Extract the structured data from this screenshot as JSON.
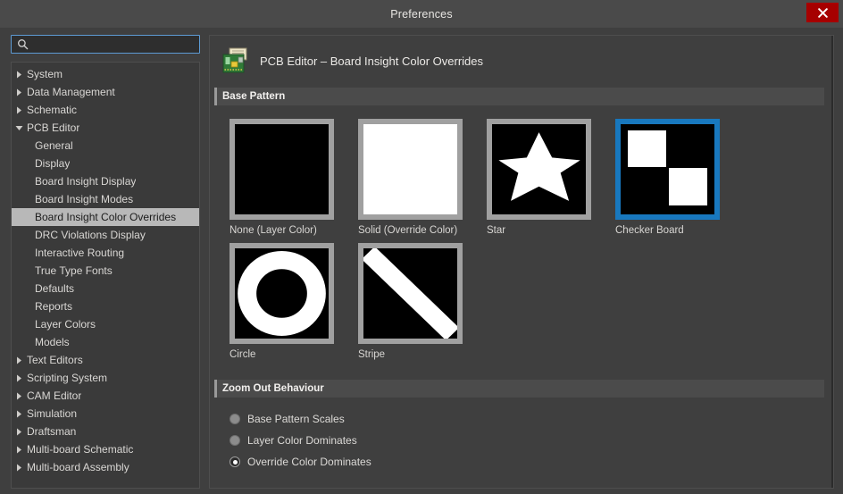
{
  "window": {
    "title": "Preferences",
    "close_label": "x",
    "close_icon": "close-icon",
    "close_color": "#a60000"
  },
  "search": {
    "value": "",
    "placeholder": "",
    "icon": "search-icon"
  },
  "tree": {
    "items": [
      {
        "label": "System",
        "depth": 0,
        "arrow": "collapsed",
        "selected": false
      },
      {
        "label": "Data Management",
        "depth": 0,
        "arrow": "collapsed",
        "selected": false
      },
      {
        "label": "Schematic",
        "depth": 0,
        "arrow": "collapsed",
        "selected": false
      },
      {
        "label": "PCB Editor",
        "depth": 0,
        "arrow": "expanded",
        "selected": false
      },
      {
        "label": "General",
        "depth": 1,
        "arrow": "none",
        "selected": false
      },
      {
        "label": "Display",
        "depth": 1,
        "arrow": "none",
        "selected": false
      },
      {
        "label": "Board Insight Display",
        "depth": 1,
        "arrow": "none",
        "selected": false
      },
      {
        "label": "Board Insight Modes",
        "depth": 1,
        "arrow": "none",
        "selected": false
      },
      {
        "label": "Board Insight Color Overrides",
        "depth": 1,
        "arrow": "none",
        "selected": true
      },
      {
        "label": "DRC Violations Display",
        "depth": 1,
        "arrow": "none",
        "selected": false
      },
      {
        "label": "Interactive Routing",
        "depth": 1,
        "arrow": "none",
        "selected": false
      },
      {
        "label": "True Type Fonts",
        "depth": 1,
        "arrow": "none",
        "selected": false
      },
      {
        "label": "Defaults",
        "depth": 1,
        "arrow": "none",
        "selected": false
      },
      {
        "label": "Reports",
        "depth": 1,
        "arrow": "none",
        "selected": false
      },
      {
        "label": "Layer Colors",
        "depth": 1,
        "arrow": "none",
        "selected": false
      },
      {
        "label": "Models",
        "depth": 1,
        "arrow": "none",
        "selected": false
      },
      {
        "label": "Text Editors",
        "depth": 0,
        "arrow": "collapsed",
        "selected": false
      },
      {
        "label": "Scripting System",
        "depth": 0,
        "arrow": "collapsed",
        "selected": false
      },
      {
        "label": "CAM Editor",
        "depth": 0,
        "arrow": "collapsed",
        "selected": false
      },
      {
        "label": "Simulation",
        "depth": 0,
        "arrow": "collapsed",
        "selected": false
      },
      {
        "label": "Draftsman",
        "depth": 0,
        "arrow": "collapsed",
        "selected": false
      },
      {
        "label": "Multi-board Schematic",
        "depth": 0,
        "arrow": "collapsed",
        "selected": false
      },
      {
        "label": "Multi-board Assembly",
        "depth": 0,
        "arrow": "collapsed",
        "selected": false
      }
    ]
  },
  "page": {
    "title": "PCB Editor – Board Insight Color Overrides",
    "icon": "pcb-board-icon"
  },
  "base_pattern": {
    "header": "Base Pattern",
    "selected": "Checker Board",
    "selection_color": "#1878be",
    "frame_color": "#a0a0a0",
    "patterns": [
      {
        "label": "None (Layer Color)",
        "shape": "none",
        "selected": false
      },
      {
        "label": "Solid (Override Color)",
        "shape": "solid",
        "selected": false
      },
      {
        "label": "Star",
        "shape": "star",
        "selected": false
      },
      {
        "label": "Checker Board",
        "shape": "checker",
        "selected": true
      },
      {
        "label": "Circle",
        "shape": "circle",
        "selected": false
      },
      {
        "label": "Stripe",
        "shape": "stripe",
        "selected": false
      }
    ]
  },
  "zoom_out_behaviour": {
    "header": "Zoom Out Behaviour",
    "selected": "Override Color Dominates",
    "options": [
      {
        "label": "Base Pattern Scales",
        "checked": false
      },
      {
        "label": "Layer Color Dominates",
        "checked": false
      },
      {
        "label": "Override Color Dominates",
        "checked": true
      }
    ]
  }
}
